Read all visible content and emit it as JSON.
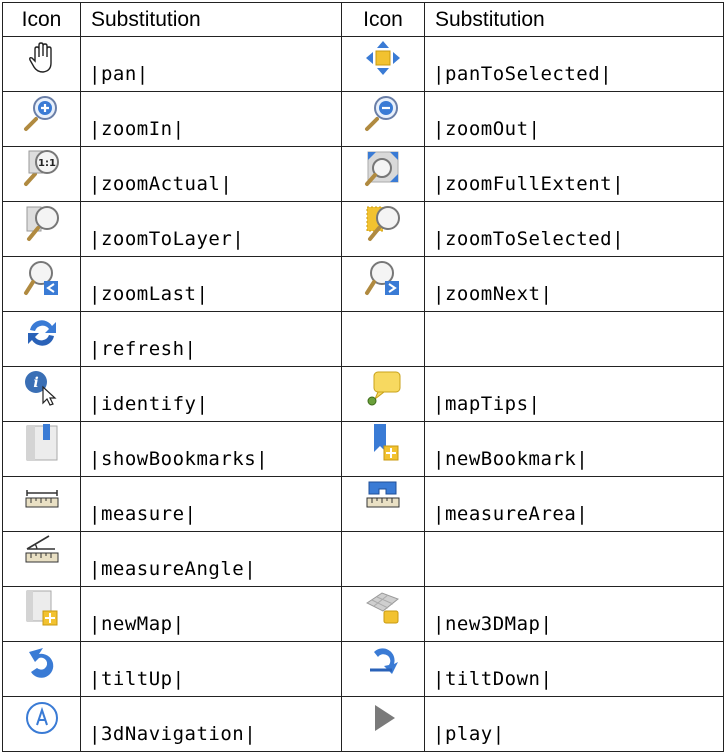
{
  "header": {
    "col_icon_1": "Icon",
    "col_sub_1": "Substitution",
    "col_icon_2": "Icon",
    "col_sub_2": "Substitution"
  },
  "rows": [
    {
      "left": {
        "icon": "hand-pan-icon",
        "sub": "|pan|"
      },
      "right": {
        "icon": "pan-to-selected-icon",
        "sub": "|panToSelected|"
      }
    },
    {
      "left": {
        "icon": "zoom-in-icon",
        "sub": "|zoomIn|"
      },
      "right": {
        "icon": "zoom-out-icon",
        "sub": "|zoomOut|"
      }
    },
    {
      "left": {
        "icon": "zoom-actual-icon",
        "sub": "|zoomActual|",
        "icon_text": "1:1"
      },
      "right": {
        "icon": "zoom-full-extent-icon",
        "sub": "|zoomFullExtent|"
      }
    },
    {
      "left": {
        "icon": "zoom-to-layer-icon",
        "sub": "|zoomToLayer|"
      },
      "right": {
        "icon": "zoom-to-selected-icon",
        "sub": "|zoomToSelected|"
      }
    },
    {
      "left": {
        "icon": "zoom-last-icon",
        "sub": "|zoomLast|"
      },
      "right": {
        "icon": "zoom-next-icon",
        "sub": "|zoomNext|"
      }
    },
    {
      "left": {
        "icon": "refresh-icon",
        "sub": "|refresh|"
      },
      "right": {
        "icon": "",
        "sub": ""
      }
    },
    {
      "left": {
        "icon": "identify-icon",
        "sub": "|identify|"
      },
      "right": {
        "icon": "map-tips-icon",
        "sub": "|mapTips|"
      }
    },
    {
      "left": {
        "icon": "show-bookmarks-icon",
        "sub": "|showBookmarks|"
      },
      "right": {
        "icon": "new-bookmark-icon",
        "sub": "|newBookmark|"
      }
    },
    {
      "left": {
        "icon": "measure-icon",
        "sub": "|measure|"
      },
      "right": {
        "icon": "measure-area-icon",
        "sub": "|measureArea|"
      }
    },
    {
      "left": {
        "icon": "measure-angle-icon",
        "sub": "|measureAngle|"
      },
      "right": {
        "icon": "",
        "sub": ""
      }
    },
    {
      "left": {
        "icon": "new-map-icon",
        "sub": "|newMap|"
      },
      "right": {
        "icon": "new-3d-map-icon",
        "sub": "|new3DMap|"
      }
    },
    {
      "left": {
        "icon": "tilt-up-icon",
        "sub": "|tiltUp|"
      },
      "right": {
        "icon": "tilt-down-icon",
        "sub": "|tiltDown|"
      }
    },
    {
      "left": {
        "icon": "3d-navigation-icon",
        "sub": "|3dNavigation|"
      },
      "right": {
        "icon": "play-icon",
        "sub": "|play|"
      }
    }
  ],
  "colors": {
    "border": "#222222",
    "accent_blue": "#3a7bd5",
    "accent_yellow": "#f2c230"
  }
}
